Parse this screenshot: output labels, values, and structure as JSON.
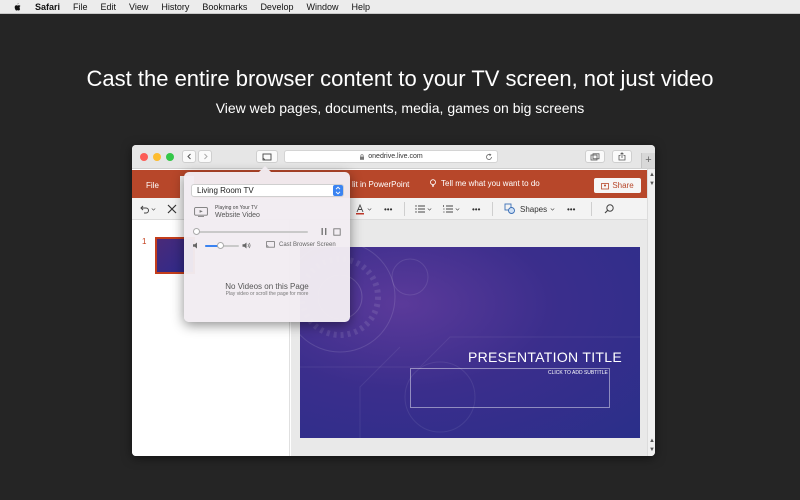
{
  "menubar": {
    "app": "Safari",
    "items": [
      "File",
      "Edit",
      "View",
      "History",
      "Bookmarks",
      "Develop",
      "Window",
      "Help"
    ]
  },
  "hero": {
    "title": "Cast the entire browser content to your TV screen, not just video",
    "subtitle": "View web pages, documents, media, games on big screens"
  },
  "browser": {
    "url": "onedrive.live.com",
    "plus": "+"
  },
  "ribbon": {
    "file_tab": "File",
    "open_in_app": "lit in PowerPoint",
    "tell_me": "Tell me what you want to do",
    "share": "Share",
    "shapes": "Shapes",
    "more": "•••"
  },
  "thumbnails": {
    "slide_number": "1"
  },
  "slide": {
    "title": "PRESENTATION TITLE",
    "subtitle": "CLICK TO ADD SUBTITLE"
  },
  "cast_popover": {
    "device": "Living Room TV",
    "status": "Playing on Your TV",
    "source": "Website Video",
    "cast_screen": "Cast Browser Screen",
    "empty_title": "No Videos on this Page",
    "empty_hint": "Play video or scroll the page for more",
    "progress": 0.0,
    "volume": 0.45
  },
  "colors": {
    "background": "#252525",
    "ribbon": "#b7472a",
    "accent": "#3a83f1"
  }
}
